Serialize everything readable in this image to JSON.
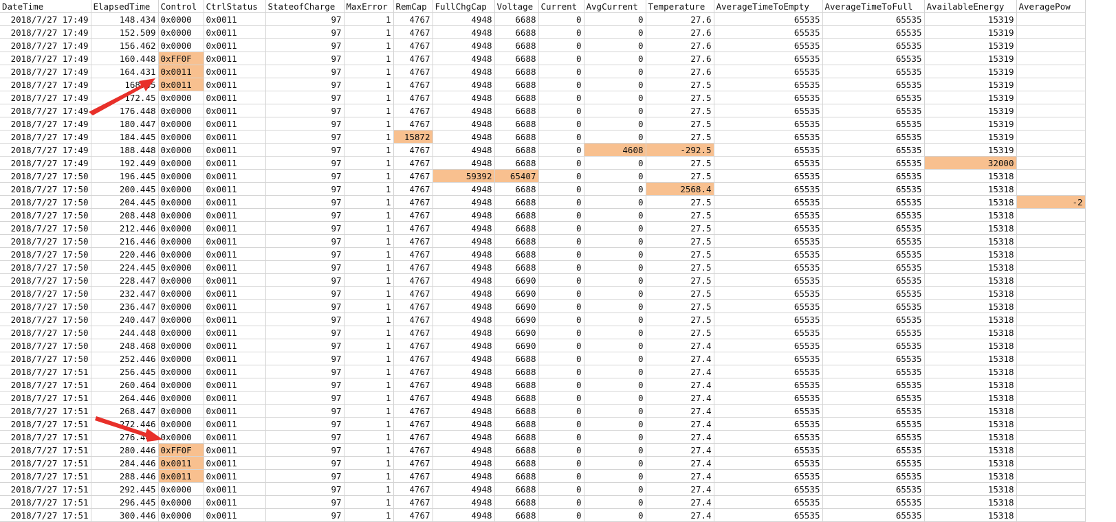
{
  "columns": [
    "DateTime",
    "ElapsedTime",
    "Control",
    "CtrlStatus",
    "StateofCharge",
    "MaxError",
    "RemCap",
    "FullChgCap",
    "Voltage",
    "Current",
    "AvgCurrent",
    "Temperature",
    "AverageTimeToEmpty",
    "AverageTimeToFull",
    "AvailableEnergy",
    "AveragePow"
  ],
  "rows": [
    [
      "2018/7/27 17:49",
      "148.434",
      "0x0000",
      "0x0011",
      "97",
      "1",
      "4767",
      "4948",
      "6688",
      "0",
      "0",
      "27.6",
      "65535",
      "65535",
      "15319",
      ""
    ],
    [
      "2018/7/27 17:49",
      "152.509",
      "0x0000",
      "0x0011",
      "97",
      "1",
      "4767",
      "4948",
      "6688",
      "0",
      "0",
      "27.6",
      "65535",
      "65535",
      "15319",
      ""
    ],
    [
      "2018/7/27 17:49",
      "156.462",
      "0x0000",
      "0x0011",
      "97",
      "1",
      "4767",
      "4948",
      "6688",
      "0",
      "0",
      "27.6",
      "65535",
      "65535",
      "15319",
      ""
    ],
    [
      "2018/7/27 17:49",
      "160.448",
      "0xFF0F",
      "0x0011",
      "97",
      "1",
      "4767",
      "4948",
      "6688",
      "0",
      "0",
      "27.6",
      "65535",
      "65535",
      "15319",
      ""
    ],
    [
      "2018/7/27 17:49",
      "164.431",
      "0x0011",
      "0x0011",
      "97",
      "1",
      "4767",
      "4948",
      "6688",
      "0",
      "0",
      "27.6",
      "65535",
      "65535",
      "15319",
      ""
    ],
    [
      "2018/7/27 17:49",
      "168.45",
      "0x0011",
      "0x0011",
      "97",
      "1",
      "4767",
      "4948",
      "6688",
      "0",
      "0",
      "27.5",
      "65535",
      "65535",
      "15319",
      ""
    ],
    [
      "2018/7/27 17:49",
      "172.45",
      "0x0000",
      "0x0011",
      "97",
      "1",
      "4767",
      "4948",
      "6688",
      "0",
      "0",
      "27.5",
      "65535",
      "65535",
      "15319",
      ""
    ],
    [
      "2018/7/27 17:49",
      "176.448",
      "0x0000",
      "0x0011",
      "97",
      "1",
      "4767",
      "4948",
      "6688",
      "0",
      "0",
      "27.5",
      "65535",
      "65535",
      "15319",
      ""
    ],
    [
      "2018/7/27 17:49",
      "180.447",
      "0x0000",
      "0x0011",
      "97",
      "1",
      "4767",
      "4948",
      "6688",
      "0",
      "0",
      "27.5",
      "65535",
      "65535",
      "15319",
      ""
    ],
    [
      "2018/7/27 17:49",
      "184.445",
      "0x0000",
      "0x0011",
      "97",
      "1",
      "15872",
      "4948",
      "6688",
      "0",
      "0",
      "27.5",
      "65535",
      "65535",
      "15319",
      ""
    ],
    [
      "2018/7/27 17:49",
      "188.448",
      "0x0000",
      "0x0011",
      "97",
      "1",
      "4767",
      "4948",
      "6688",
      "0",
      "4608",
      "-292.5",
      "65535",
      "65535",
      "15319",
      ""
    ],
    [
      "2018/7/27 17:49",
      "192.449",
      "0x0000",
      "0x0011",
      "97",
      "1",
      "4767",
      "4948",
      "6688",
      "0",
      "0",
      "27.5",
      "65535",
      "65535",
      "32000",
      ""
    ],
    [
      "2018/7/27 17:50",
      "196.445",
      "0x0000",
      "0x0011",
      "97",
      "1",
      "4767",
      "59392",
      "65407",
      "0",
      "0",
      "27.5",
      "65535",
      "65535",
      "15318",
      ""
    ],
    [
      "2018/7/27 17:50",
      "200.445",
      "0x0000",
      "0x0011",
      "97",
      "1",
      "4767",
      "4948",
      "6688",
      "0",
      "0",
      "2568.4",
      "65535",
      "65535",
      "15318",
      ""
    ],
    [
      "2018/7/27 17:50",
      "204.445",
      "0x0000",
      "0x0011",
      "97",
      "1",
      "4767",
      "4948",
      "6688",
      "0",
      "0",
      "27.5",
      "65535",
      "65535",
      "15318",
      "-2"
    ],
    [
      "2018/7/27 17:50",
      "208.448",
      "0x0000",
      "0x0011",
      "97",
      "1",
      "4767",
      "4948",
      "6688",
      "0",
      "0",
      "27.5",
      "65535",
      "65535",
      "15318",
      ""
    ],
    [
      "2018/7/27 17:50",
      "212.446",
      "0x0000",
      "0x0011",
      "97",
      "1",
      "4767",
      "4948",
      "6688",
      "0",
      "0",
      "27.5",
      "65535",
      "65535",
      "15318",
      ""
    ],
    [
      "2018/7/27 17:50",
      "216.446",
      "0x0000",
      "0x0011",
      "97",
      "1",
      "4767",
      "4948",
      "6688",
      "0",
      "0",
      "27.5",
      "65535",
      "65535",
      "15318",
      ""
    ],
    [
      "2018/7/27 17:50",
      "220.446",
      "0x0000",
      "0x0011",
      "97",
      "1",
      "4767",
      "4948",
      "6688",
      "0",
      "0",
      "27.5",
      "65535",
      "65535",
      "15318",
      ""
    ],
    [
      "2018/7/27 17:50",
      "224.445",
      "0x0000",
      "0x0011",
      "97",
      "1",
      "4767",
      "4948",
      "6688",
      "0",
      "0",
      "27.5",
      "65535",
      "65535",
      "15318",
      ""
    ],
    [
      "2018/7/27 17:50",
      "228.447",
      "0x0000",
      "0x0011",
      "97",
      "1",
      "4767",
      "4948",
      "6690",
      "0",
      "0",
      "27.5",
      "65535",
      "65535",
      "15318",
      ""
    ],
    [
      "2018/7/27 17:50",
      "232.447",
      "0x0000",
      "0x0011",
      "97",
      "1",
      "4767",
      "4948",
      "6690",
      "0",
      "0",
      "27.5",
      "65535",
      "65535",
      "15318",
      ""
    ],
    [
      "2018/7/27 17:50",
      "236.447",
      "0x0000",
      "0x0011",
      "97",
      "1",
      "4767",
      "4948",
      "6690",
      "0",
      "0",
      "27.5",
      "65535",
      "65535",
      "15318",
      ""
    ],
    [
      "2018/7/27 17:50",
      "240.447",
      "0x0000",
      "0x0011",
      "97",
      "1",
      "4767",
      "4948",
      "6690",
      "0",
      "0",
      "27.5",
      "65535",
      "65535",
      "15318",
      ""
    ],
    [
      "2018/7/27 17:50",
      "244.448",
      "0x0000",
      "0x0011",
      "97",
      "1",
      "4767",
      "4948",
      "6690",
      "0",
      "0",
      "27.5",
      "65535",
      "65535",
      "15318",
      ""
    ],
    [
      "2018/7/27 17:50",
      "248.468",
      "0x0000",
      "0x0011",
      "97",
      "1",
      "4767",
      "4948",
      "6690",
      "0",
      "0",
      "27.4",
      "65535",
      "65535",
      "15318",
      ""
    ],
    [
      "2018/7/27 17:50",
      "252.446",
      "0x0000",
      "0x0011",
      "97",
      "1",
      "4767",
      "4948",
      "6688",
      "0",
      "0",
      "27.4",
      "65535",
      "65535",
      "15318",
      ""
    ],
    [
      "2018/7/27 17:51",
      "256.445",
      "0x0000",
      "0x0011",
      "97",
      "1",
      "4767",
      "4948",
      "6688",
      "0",
      "0",
      "27.4",
      "65535",
      "65535",
      "15318",
      ""
    ],
    [
      "2018/7/27 17:51",
      "260.464",
      "0x0000",
      "0x0011",
      "97",
      "1",
      "4767",
      "4948",
      "6688",
      "0",
      "0",
      "27.4",
      "65535",
      "65535",
      "15318",
      ""
    ],
    [
      "2018/7/27 17:51",
      "264.446",
      "0x0000",
      "0x0011",
      "97",
      "1",
      "4767",
      "4948",
      "6688",
      "0",
      "0",
      "27.4",
      "65535",
      "65535",
      "15318",
      ""
    ],
    [
      "2018/7/27 17:51",
      "268.447",
      "0x0000",
      "0x0011",
      "97",
      "1",
      "4767",
      "4948",
      "6688",
      "0",
      "0",
      "27.4",
      "65535",
      "65535",
      "15318",
      ""
    ],
    [
      "2018/7/27 17:51",
      "272.446",
      "0x0000",
      "0x0011",
      "97",
      "1",
      "4767",
      "4948",
      "6688",
      "0",
      "0",
      "27.4",
      "65535",
      "65535",
      "15318",
      ""
    ],
    [
      "2018/7/27 17:51",
      "276.446",
      "0x0000",
      "0x0011",
      "97",
      "1",
      "4767",
      "4948",
      "6688",
      "0",
      "0",
      "27.4",
      "65535",
      "65535",
      "15318",
      ""
    ],
    [
      "2018/7/27 17:51",
      "280.446",
      "0xFF0F",
      "0x0011",
      "97",
      "1",
      "4767",
      "4948",
      "6688",
      "0",
      "0",
      "27.4",
      "65535",
      "65535",
      "15318",
      ""
    ],
    [
      "2018/7/27 17:51",
      "284.446",
      "0x0011",
      "0x0011",
      "97",
      "1",
      "4767",
      "4948",
      "6688",
      "0",
      "0",
      "27.4",
      "65535",
      "65535",
      "15318",
      ""
    ],
    [
      "2018/7/27 17:51",
      "288.446",
      "0x0011",
      "0x0011",
      "97",
      "1",
      "4767",
      "4948",
      "6688",
      "0",
      "0",
      "27.4",
      "65535",
      "65535",
      "15318",
      ""
    ],
    [
      "2018/7/27 17:51",
      "292.445",
      "0x0000",
      "0x0011",
      "97",
      "1",
      "4767",
      "4948",
      "6688",
      "0",
      "0",
      "27.4",
      "65535",
      "65535",
      "15318",
      ""
    ],
    [
      "2018/7/27 17:51",
      "296.445",
      "0x0000",
      "0x0011",
      "97",
      "1",
      "4767",
      "4948",
      "6688",
      "0",
      "0",
      "27.4",
      "65535",
      "65535",
      "15318",
      ""
    ],
    [
      "2018/7/27 17:51",
      "300.446",
      "0x0000",
      "0x0011",
      "97",
      "1",
      "4767",
      "4948",
      "6688",
      "0",
      "0",
      "27.4",
      "65535",
      "65535",
      "15318",
      ""
    ]
  ],
  "highlights": [
    [
      3,
      2
    ],
    [
      4,
      2
    ],
    [
      5,
      2
    ],
    [
      9,
      6
    ],
    [
      10,
      10
    ],
    [
      10,
      11
    ],
    [
      11,
      14
    ],
    [
      12,
      7
    ],
    [
      12,
      8
    ],
    [
      13,
      11
    ],
    [
      14,
      15
    ],
    [
      33,
      2
    ],
    [
      34,
      2
    ],
    [
      35,
      2
    ]
  ],
  "colors": {
    "highlight": "#f8c08f",
    "gridline": "#d4d4d4",
    "arrow": "#e8302a"
  },
  "annotations": [
    "red-arrow",
    "red-arrow"
  ]
}
